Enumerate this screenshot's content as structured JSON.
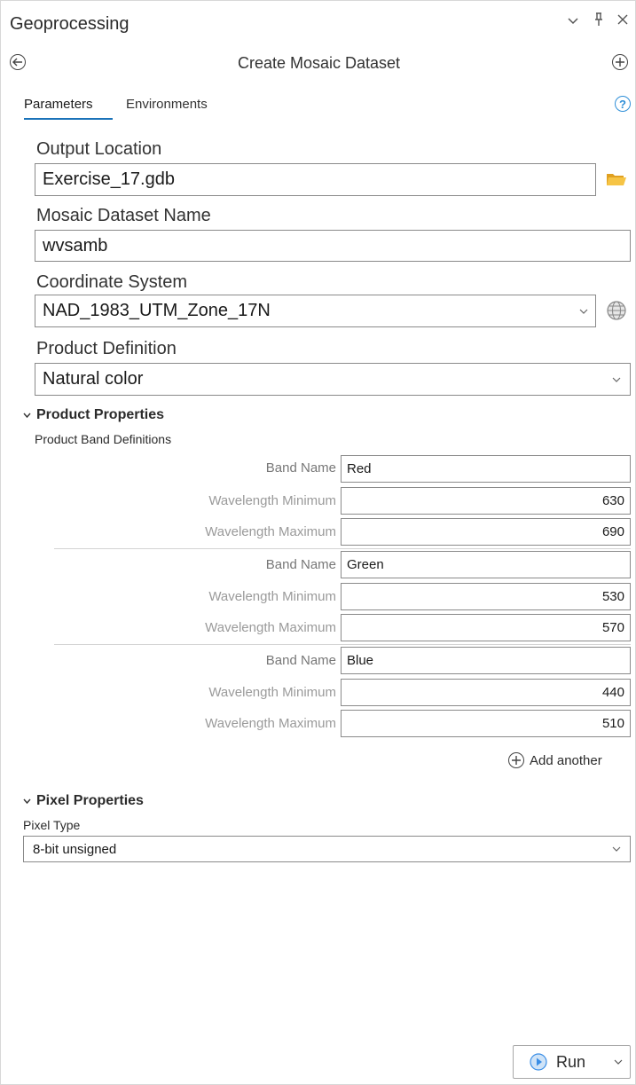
{
  "window": {
    "title": "Geoprocessing",
    "controls": {
      "collapse": "⌄",
      "pin": "ꟼ",
      "close": "✕"
    }
  },
  "tool": {
    "title": "Create Mosaic Dataset"
  },
  "tabs": {
    "parameters": "Parameters",
    "environments": "Environments"
  },
  "help_glyph": "?",
  "params": {
    "output_location": {
      "label": "Output Location",
      "value": "Exercise_17.gdb"
    },
    "dataset_name": {
      "label": "Mosaic Dataset Name",
      "value": "wvsamb"
    },
    "coordinate_system": {
      "label": "Coordinate System",
      "value": "NAD_1983_UTM_Zone_17N"
    },
    "product_definition": {
      "label": "Product Definition",
      "value": "Natural color"
    }
  },
  "product_properties": {
    "header": "Product Properties",
    "sublabel": "Product Band Definitions",
    "labels": {
      "band_name": "Band Name",
      "wl_min": "Wavelength Minimum",
      "wl_max": "Wavelength Maximum"
    },
    "bands": [
      {
        "name": "Red",
        "min": "630",
        "max": "690"
      },
      {
        "name": "Green",
        "min": "530",
        "max": "570"
      },
      {
        "name": "Blue",
        "min": "440",
        "max": "510"
      }
    ],
    "add_another": "Add another"
  },
  "pixel_properties": {
    "header": "Pixel Properties",
    "pixel_type_label": "Pixel Type",
    "pixel_type_value": "8-bit unsigned"
  },
  "run": {
    "label": "Run"
  },
  "icons": {
    "back": "back-arrow-icon",
    "add": "add-icon",
    "folder": "folder-icon",
    "globe": "globe-icon",
    "chevron": "chevron-down-icon",
    "play": "play-icon"
  },
  "colors": {
    "accent": "#1b73b9",
    "help": "#2f8fd8",
    "folder": "#f2b632",
    "run_play": "#3a8ee6"
  }
}
